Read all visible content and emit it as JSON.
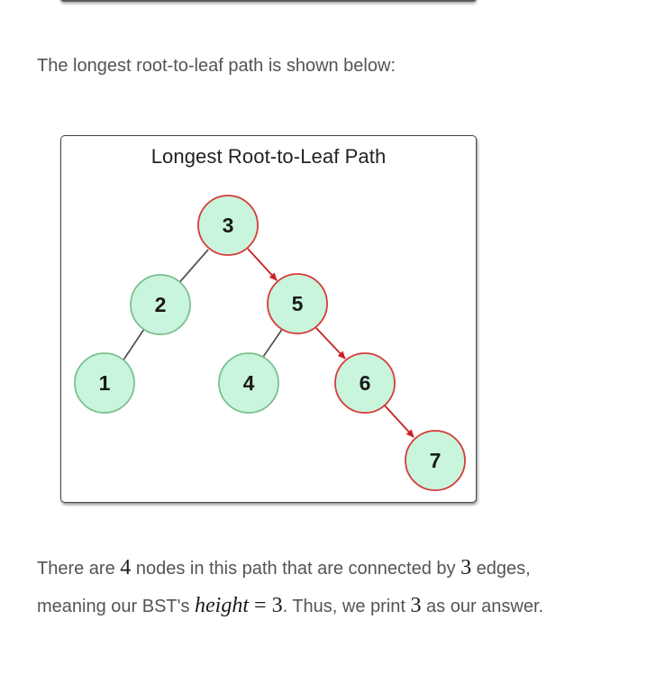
{
  "intro_text": "The longest root-to-leaf path is shown below:",
  "figure": {
    "title": "Longest Root-to-Leaf Path",
    "nodes": [
      {
        "label": "3",
        "on_path": true
      },
      {
        "label": "2",
        "on_path": false
      },
      {
        "label": "5",
        "on_path": true
      },
      {
        "label": "1",
        "on_path": false
      },
      {
        "label": "4",
        "on_path": false
      },
      {
        "label": "6",
        "on_path": true
      },
      {
        "label": "7",
        "on_path": true
      }
    ],
    "colors": {
      "node_fill": "#c8f5dc",
      "path_border": "#d63a3a",
      "normal_border": "#7dbf8e",
      "path_edge": "#cc1f1f",
      "normal_edge": "#555555"
    }
  },
  "explanation": {
    "line1": {
      "part1": "There are ",
      "nodes_count": "4",
      "part2": " nodes in this path that are connected by ",
      "edges_count": "3",
      "part3": " edges,"
    },
    "line2": {
      "part1": "meaning our BST's ",
      "height_var": "height",
      "equals": " = ",
      "height_value": "3",
      "part2": ". Thus, we print ",
      "answer": "3",
      "part3": " as our answer."
    }
  }
}
